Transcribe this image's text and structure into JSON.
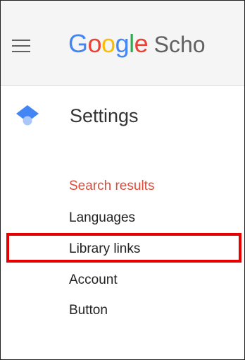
{
  "header": {
    "logo_letters": [
      {
        "char": "G",
        "color": "#4285f4"
      },
      {
        "char": "o",
        "color": "#ea4335"
      },
      {
        "char": "o",
        "color": "#fbbc05"
      },
      {
        "char": "g",
        "color": "#4285f4"
      },
      {
        "char": "l",
        "color": "#34a853"
      },
      {
        "char": "e",
        "color": "#ea4335"
      }
    ],
    "logo_suffix": "Scho",
    "menu_icon": "hamburger-menu-icon"
  },
  "settings": {
    "title": "Settings",
    "icon": "graduation-cap-icon",
    "icon_color": "#4285f4"
  },
  "menu": {
    "items": [
      {
        "label": "Search results",
        "active": true
      },
      {
        "label": "Languages",
        "active": false
      },
      {
        "label": "Library links",
        "active": false,
        "highlighted": true
      },
      {
        "label": "Account",
        "active": false
      },
      {
        "label": "Button",
        "active": false
      }
    ],
    "active_color": "#dd4b39",
    "highlight_color": "#e60000"
  }
}
